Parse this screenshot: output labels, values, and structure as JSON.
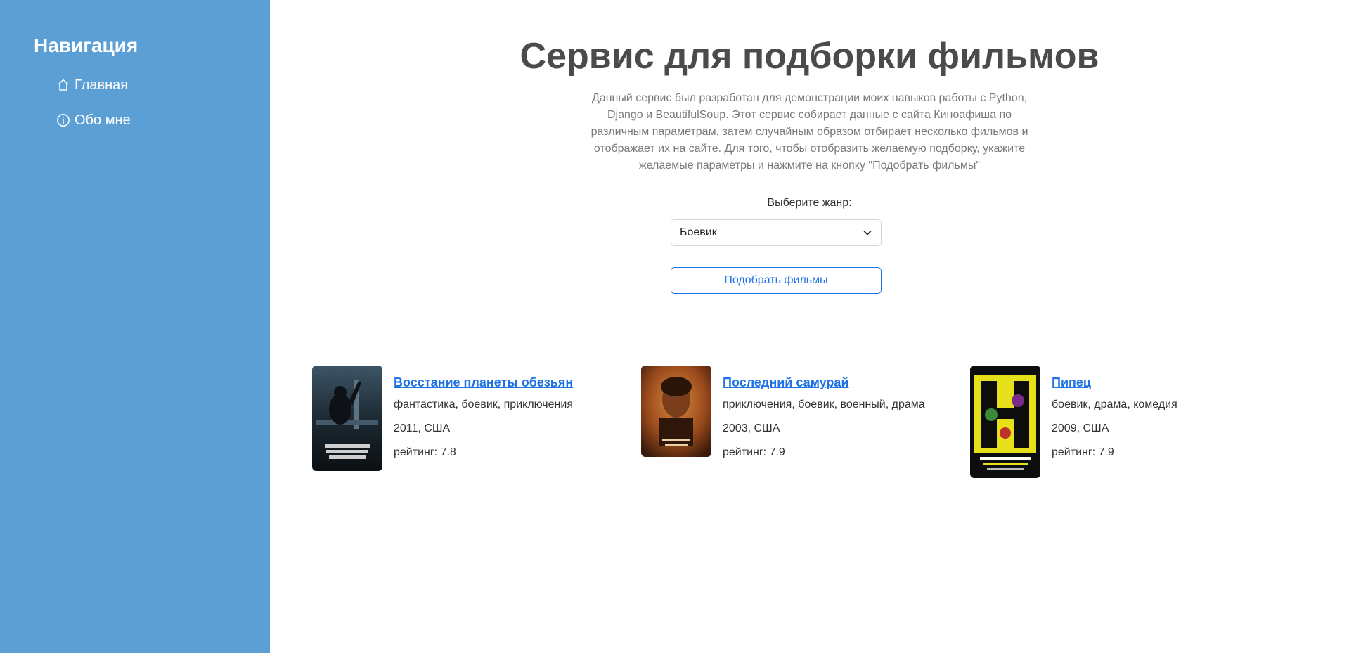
{
  "sidebar": {
    "title": "Навигация",
    "items": [
      {
        "label": "Главная",
        "icon": "house-icon"
      },
      {
        "label": "Обо мне",
        "icon": "info-circle-icon"
      }
    ],
    "background": "#5c9fd5"
  },
  "main": {
    "title": "Сервис для подборки фильмов",
    "lead": "Данный сервис был разработан для демонстрации моих навыков работы с Python, Django и BeautifulSoup. Этот сервис собирает данные с сайта Киноафиша по различным параметрам, затем случайным образом отбирает несколько фильмов и отображает их на сайте. Для того, чтобы отобразить желаемую подборку, укажите желаемые параметры и нажмите на кнопку \"Подобрать фильмы\"",
    "genre_label": "Выберите жанр:",
    "genre_selected": "Боевик",
    "submit_label": "Подобрать фильмы",
    "accent": "#1f73e6"
  },
  "films": [
    {
      "title": "Восстание планеты обезьян",
      "genres": "фантастика, боевик, приключения",
      "year_country": "2011, США",
      "rating": "рейтинг: 7.8"
    },
    {
      "title": "Последний самурай",
      "genres": "приключения, боевик, военный, драма",
      "year_country": "2003, США",
      "rating": "рейтинг: 7.9"
    },
    {
      "title": "Пипец",
      "genres": "боевик, драма, комедия",
      "year_country": "2009, США",
      "rating": "рейтинг: 7.9"
    }
  ]
}
